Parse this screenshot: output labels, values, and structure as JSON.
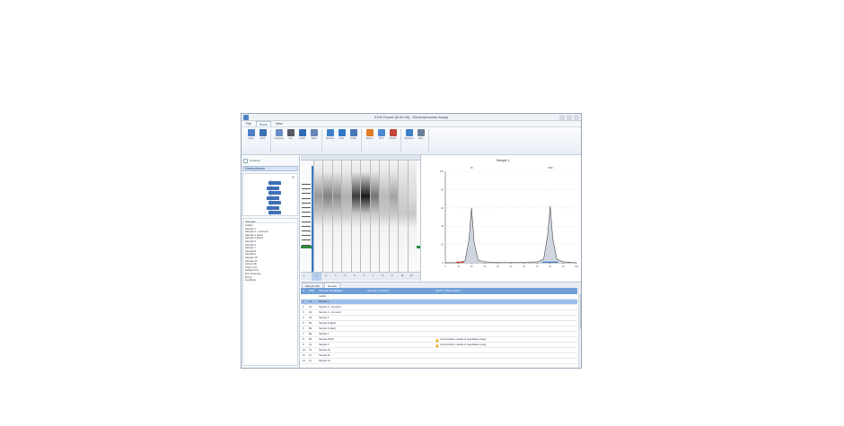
{
  "window": {
    "title": "2100 Expert (B.02.08) - Electrophoresis Assay"
  },
  "menu": {
    "tabs": [
      "File",
      "Home",
      "View"
    ]
  },
  "ribbon": {
    "buttons": [
      {
        "label": "Open",
        "icon": "folder-icon",
        "color": "#4f81c7"
      },
      {
        "label": "Save",
        "icon": "save-icon",
        "color": "#3b6fb3"
      },
      {
        "label": "Compare",
        "icon": "compare-icon",
        "color": "#6a8fc4"
      },
      {
        "label": "Gel",
        "icon": "gel-icon",
        "color": "#555b66"
      },
      {
        "label": "Graph",
        "icon": "graph-icon",
        "color": "#2f6bb5"
      },
      {
        "label": "Table",
        "icon": "table-icon",
        "color": "#6687b5"
      },
      {
        "label": "Results",
        "icon": "results-icon",
        "color": "#3b7fc7"
      },
      {
        "label": "Filter",
        "icon": "filter-icon",
        "color": "#2f79c6"
      },
      {
        "label": "Scale",
        "icon": "scale-icon",
        "color": "#4977b8"
      },
      {
        "label": "Export",
        "icon": "export-icon",
        "color": "#e07d27"
      },
      {
        "label": "Print",
        "icon": "print-icon",
        "color": "#4a8ad0"
      },
      {
        "label": "Report",
        "icon": "report-icon",
        "color": "#c3443a"
      },
      {
        "label": "Setpoints",
        "icon": "setpoints-icon",
        "color": "#3b7fc7"
      },
      {
        "label": "Help",
        "icon": "help-icon",
        "color": "#6c7f99"
      }
    ]
  },
  "left": {
    "toolbar_text": "Contexts",
    "section": "Electrophoresis",
    "list_header": "Samples",
    "tree_nodes": 7,
    "list": [
      "Ladder",
      "Sample 1",
      "Sample 2 - comment",
      "Sample 3 (alert)",
      "Sample 4 (alert)",
      "Sample 5",
      "Sample 6",
      "Sample 7",
      "Sample 8",
      "Sample 9",
      "Sample 10",
      "Sample 11",
      "Assay Info",
      "Chip Lot #",
      "Reagent Kit",
      "Run Summary",
      "Errors",
      "Log Book"
    ]
  },
  "gel": {
    "lanes": [
      "L",
      "1",
      "2",
      "3",
      "4",
      "5",
      "6",
      "7",
      "8",
      "9",
      "10",
      "11"
    ],
    "lane_intensity": [
      0.1,
      0.45,
      0.55,
      0.5,
      0.35,
      0.85,
      1.0,
      0.6,
      0.3,
      0.4,
      0.2,
      0.15
    ],
    "marker_color": "#2e8b3e",
    "selection_color": "#3a78c8"
  },
  "graph": {
    "title": "Sample 1",
    "peak_labels": [
      "15",
      "1500"
    ]
  },
  "chart_data": {
    "type": "line",
    "title": "Sample 1",
    "xlabel": "",
    "ylabel": "",
    "x": [
      0,
      10,
      15,
      18,
      20,
      22,
      25,
      30,
      40,
      50,
      60,
      70,
      75,
      78,
      80,
      82,
      85,
      90,
      100
    ],
    "series": [
      {
        "values": [
          0,
          0,
          2,
          25,
          60,
          22,
          3,
          1,
          0.5,
          0.5,
          0.5,
          1,
          4,
          30,
          62,
          26,
          4,
          1,
          0
        ]
      }
    ],
    "ylim": [
      0,
      100
    ],
    "xlim": [
      0,
      100
    ],
    "grid": true
  },
  "table": {
    "tabs": [
      "Sample Info",
      "Results"
    ],
    "headers": [
      "#",
      "Well",
      "Sample Name",
      "Status",
      "Sample Comment",
      "Alerts / Observations"
    ],
    "rows": [
      {
        "n": "",
        "well": "",
        "name": "Ladder",
        "status": "",
        "comment": "",
        "alert": ""
      },
      {
        "n": "1",
        "well": "A1",
        "name": "Sample 1",
        "status": "",
        "comment": "",
        "alert": "",
        "selected": true
      },
      {
        "n": "2",
        "well": "A2",
        "name": "Sample 2 - comment",
        "status": "",
        "comment": "",
        "alert": ""
      },
      {
        "n": "3",
        "well": "A3",
        "name": "Sample 3 - comment",
        "status": "",
        "comment": "",
        "alert": ""
      },
      {
        "n": "4",
        "well": "A4",
        "name": "Sample 4",
        "status": "",
        "comment": "",
        "alert": ""
      },
      {
        "n": "5",
        "well": "B1",
        "name": "Sample 5 (alert)",
        "status": "",
        "comment": "",
        "alert": ""
      },
      {
        "n": "6",
        "well": "B2",
        "name": "Sample 6 (alert)",
        "status": "",
        "comment": "",
        "alert": ""
      },
      {
        "n": "7",
        "well": "B3",
        "name": "Sample 7",
        "status": "",
        "comment": "",
        "alert": ""
      },
      {
        "n": "8",
        "well": "B4",
        "name": "Sample 8 RIN",
        "status": "",
        "comment": "",
        "alert": "Concentration outside of quantitative range",
        "warn": true
      },
      {
        "n": "9",
        "well": "C1",
        "name": "Sample 9",
        "status": "",
        "comment": "",
        "alert": "Concentration outside of quantitative range",
        "warn": true
      },
      {
        "n": "10",
        "well": "C2",
        "name": "Sample 10",
        "status": "",
        "comment": "",
        "alert": ""
      },
      {
        "n": "11",
        "well": "C3",
        "name": "Sample 11",
        "status": "",
        "comment": "",
        "alert": ""
      },
      {
        "n": "12",
        "well": "C4",
        "name": "Sample 12",
        "status": "",
        "comment": "",
        "alert": ""
      }
    ]
  }
}
